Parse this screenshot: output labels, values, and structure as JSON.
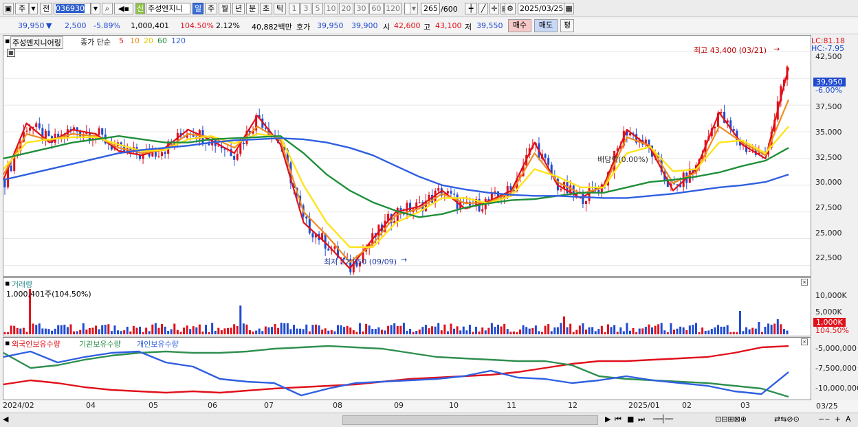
{
  "toolbar": {
    "period_main": "주",
    "prev_label": "전",
    "code": "036930",
    "new_badge": "신",
    "stock_name": "주성엔지니",
    "periods": [
      "일",
      "주",
      "월",
      "년",
      "분",
      "초",
      "틱"
    ],
    "selected_period": "일",
    "intervals": [
      "1",
      "3",
      "5",
      "10",
      "20",
      "30",
      "60",
      "120"
    ],
    "count_value": "265",
    "count_max": "/600",
    "date": "2025/03/25"
  },
  "quote": {
    "price": "39,950",
    "change": "2,500",
    "change_pct": "-5.89%",
    "volume": "1,000,401",
    "vol_ratio": "104.50%",
    "turnover": "2.12%",
    "amount": "40,882백만",
    "ask_label": "호가",
    "ask": "39,950",
    "bid": "39,900",
    "open_label": "시",
    "open": "42,600",
    "high_label": "고",
    "high": "43,100",
    "low_label": "저",
    "low": "39,550",
    "buy_label": "매수",
    "sell_label": "매도",
    "flat_label": "평"
  },
  "price_panel": {
    "name_tag": "주성엔지니어링",
    "legend_prefix": "종가 단순",
    "ma_periods": [
      "5",
      "10",
      "20",
      "60",
      "120"
    ],
    "lc": "LC:81.18",
    "hc": "HC:-7.95",
    "current_price_tag": "39,950",
    "current_pct_tag": "-6.00%",
    "high_annotation": "최고 43,400 (03/21)",
    "low_annotation": "최저 22,050 (09/09)",
    "dividend_annotation": "배당락(0.00%)",
    "yticks": [
      "42,500",
      "40,000",
      "37,500",
      "35,000",
      "32,500",
      "30,000",
      "27,500",
      "25,000",
      "22,500"
    ]
  },
  "volume_panel": {
    "title": "거래량",
    "value": "1,000,401주(104.50%)",
    "yticks": [
      "10,000K",
      "5,000K"
    ],
    "current_tag": "1,000K",
    "current_pct": "104.50%"
  },
  "holdings_panel": {
    "legends": [
      "외국인보유수량",
      "기관보유수량",
      "개인보유수량"
    ],
    "yticks": [
      "-5,000,000",
      "-7,500,000",
      "-10,000,000"
    ]
  },
  "x_axis": {
    "labels": [
      "2024/02",
      "04",
      "05",
      "06",
      "07",
      "08",
      "09",
      "10",
      "11",
      "12",
      "2025/01",
      "02",
      "03"
    ],
    "right_label": "03/25"
  },
  "colors": {
    "ma5": "#e0101a",
    "ma10": "#f08c1e",
    "ma20": "#ffe31a",
    "ma60": "#1f8f3a",
    "ma120": "#2f5fe0",
    "up": "#e0101a",
    "down": "#1f4ad0",
    "foreign": "#e0101a",
    "institution": "#2f8f4f",
    "individual": "#2f5fe0"
  },
  "chart_data": {
    "type": "line",
    "title": "주성엔지니어링",
    "x_range": [
      "2024/02",
      "2025/03/25"
    ],
    "ylim": [
      21500,
      44000
    ],
    "series": [
      {
        "name": "5",
        "values": [
          30500,
          35800,
          34000,
          35200,
          34800,
          33200,
          32800,
          33500,
          35200,
          34200,
          33000,
          36500,
          33800,
          26500,
          24500,
          22200,
          25000,
          27500,
          28000,
          29500,
          27800,
          28500,
          29500,
          34000,
          30000,
          28800,
          30000,
          35200,
          33500,
          29500,
          31500,
          36800,
          33800,
          32500,
          41000
        ]
      },
      {
        "name": "10",
        "values": [
          31000,
          34800,
          34200,
          34800,
          34600,
          33500,
          33000,
          33300,
          34800,
          34500,
          33500,
          35500,
          34200,
          27500,
          25300,
          22800,
          24500,
          27200,
          27800,
          29200,
          28300,
          28400,
          29300,
          33000,
          30300,
          29200,
          29800,
          34500,
          33700,
          30200,
          31200,
          35500,
          34000,
          32800,
          38000
        ]
      },
      {
        "name": "20",
        "values": [
          31500,
          34000,
          34300,
          34500,
          34500,
          33800,
          33200,
          33300,
          34300,
          34600,
          33900,
          34800,
          34500,
          30000,
          26500,
          24200,
          24200,
          26500,
          27500,
          28800,
          28800,
          28300,
          29000,
          31500,
          30800,
          29800,
          29800,
          33000,
          33600,
          31300,
          31500,
          34000,
          34200,
          33000,
          35500
        ]
      },
      {
        "name": "60",
        "values": [
          32500,
          33000,
          33500,
          34000,
          34300,
          34600,
          34300,
          34000,
          34000,
          34300,
          34400,
          34500,
          34600,
          33000,
          31000,
          29500,
          28400,
          27600,
          27000,
          27300,
          27900,
          28300,
          28600,
          28700,
          29000,
          29300,
          29300,
          29800,
          30300,
          30500,
          30800,
          31200,
          31800,
          32300,
          33500
        ]
      },
      {
        "name": "120",
        "values": [
          30500,
          31000,
          31500,
          32000,
          32500,
          33000,
          33300,
          33500,
          33700,
          34000,
          34200,
          34300,
          34400,
          34300,
          34000,
          33500,
          32800,
          31800,
          30800,
          30000,
          29600,
          29300,
          29100,
          29000,
          29000,
          28900,
          28800,
          28800,
          29000,
          29200,
          29500,
          29800,
          30000,
          30300,
          31000
        ]
      }
    ]
  }
}
